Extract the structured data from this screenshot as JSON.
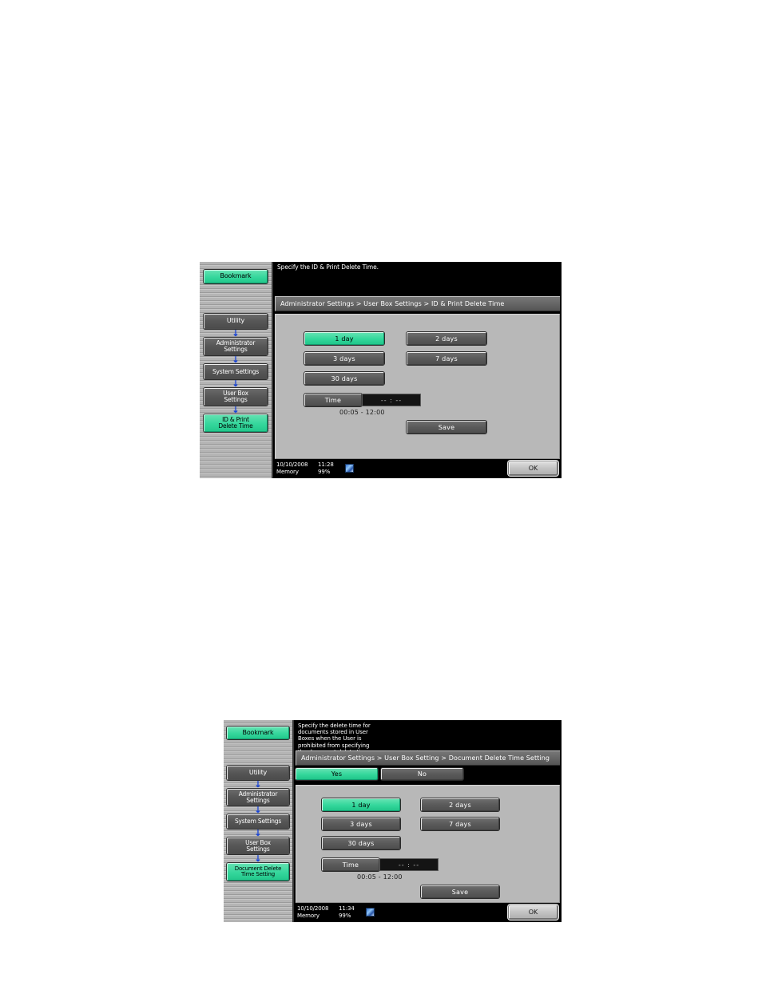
{
  "page": {
    "background": "#ffffff",
    "accent_green": "#33d79b",
    "button_gray": "#5a5a5a",
    "panel_bg": "#b8b8b8"
  },
  "screens": [
    {
      "id": "id-print-delete-time",
      "message": "Specify the ID & Print Delete Time.",
      "breadcrumb": "Administrator Settings > User Box Settings > ID & Print Delete Time",
      "sidebar": {
        "bookmark": "Bookmark",
        "items": [
          {
            "label": "Utility",
            "selected": false
          },
          {
            "label": "Administrator\nSettings",
            "selected": false
          },
          {
            "label": "System Settings",
            "selected": false
          },
          {
            "label": "User Box\nSettings",
            "selected": false
          },
          {
            "label": "ID & Print\nDelete Time",
            "selected": true
          }
        ],
        "arrow": "↓"
      },
      "options": [
        {
          "label": "1 day",
          "selected": true
        },
        {
          "label": "2 days",
          "selected": false
        },
        {
          "label": "3 days",
          "selected": false
        },
        {
          "label": "7 days",
          "selected": false
        },
        {
          "label": "30 days",
          "selected": false
        }
      ],
      "time": {
        "button_label": "Time",
        "value": "-- : --",
        "range": "00:05  -  12:00"
      },
      "save_label": "Save",
      "status": {
        "date": "10/10/2008",
        "time": "11:28",
        "memory_label": "Memory",
        "memory_value": "99%",
        "icon": "memory-icon"
      },
      "ok_label": "OK"
    },
    {
      "id": "document-delete-time-setting",
      "message": "Specify the delete time for\ndocuments stored in User\nBoxes when the User is\nprohibited from specifying\nthe document delete time.",
      "breadcrumb": "Administrator Settings > User Box Setting > Document Delete Time Setting",
      "sidebar": {
        "bookmark": "Bookmark",
        "items": [
          {
            "label": "Utility",
            "selected": false
          },
          {
            "label": "Administrator\nSettings",
            "selected": false
          },
          {
            "label": "System Settings",
            "selected": false
          },
          {
            "label": "User Box\nSettings",
            "selected": false
          },
          {
            "label": "Document Delete\nTime Setting",
            "selected": true
          }
        ],
        "arrow": "↓"
      },
      "toggle": [
        {
          "label": "Yes",
          "selected": true
        },
        {
          "label": "No",
          "selected": false
        }
      ],
      "options": [
        {
          "label": "1 day",
          "selected": true
        },
        {
          "label": "2 days",
          "selected": false
        },
        {
          "label": "3 days",
          "selected": false
        },
        {
          "label": "7 days",
          "selected": false
        },
        {
          "label": "30 days",
          "selected": false
        }
      ],
      "time": {
        "button_label": "Time",
        "value": "-- : --",
        "range": "00:05  -  12:00"
      },
      "save_label": "Save",
      "status": {
        "date": "10/10/2008",
        "time": "11:34",
        "memory_label": "Memory",
        "memory_value": "99%",
        "icon": "memory-icon"
      },
      "ok_label": "OK"
    }
  ]
}
